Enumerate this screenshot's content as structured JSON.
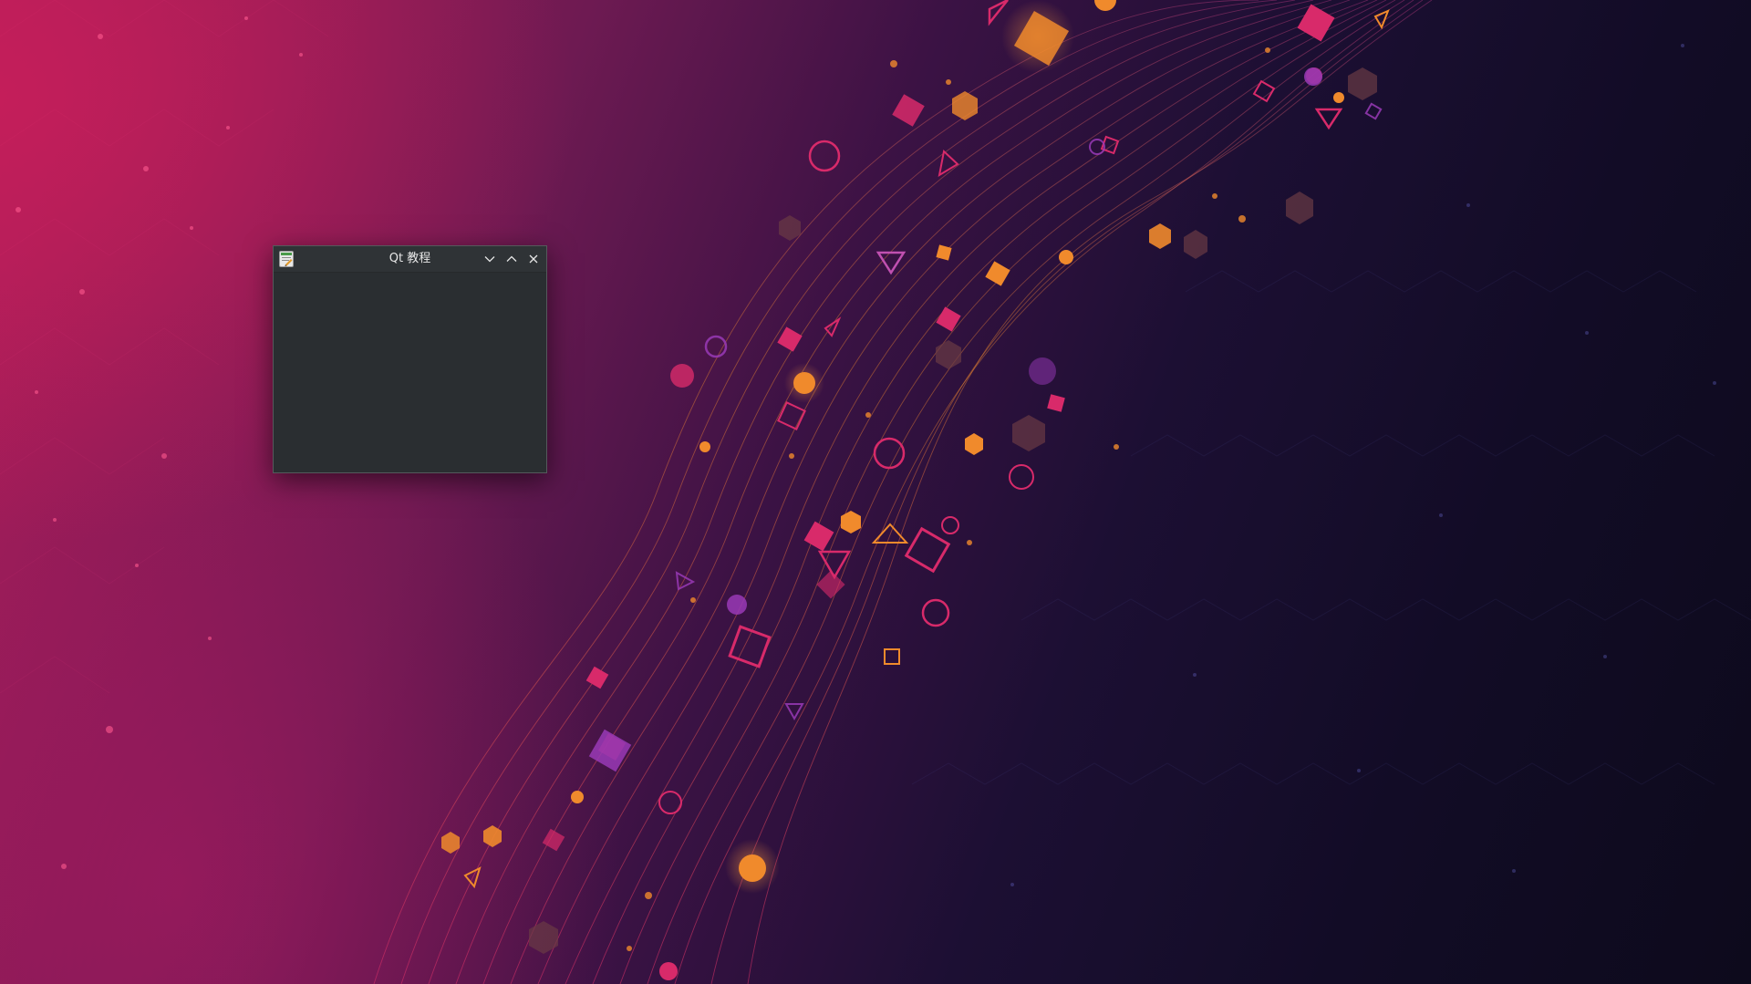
{
  "window": {
    "title": "Qt 教程",
    "icon": "qt-app-icon",
    "controls": {
      "minimize_icon": "chevron-down-icon",
      "maximize_icon": "chevron-up-icon",
      "close_icon": "close-icon"
    }
  },
  "colors": {
    "titlebar": "#2f3336",
    "window_body": "#2a2e31",
    "title_text": "#e6e6e6",
    "wallpaper_accent_pink": "#d0215f",
    "wallpaper_accent_orange": "#f08a2c",
    "wallpaper_dark": "#120c26"
  }
}
